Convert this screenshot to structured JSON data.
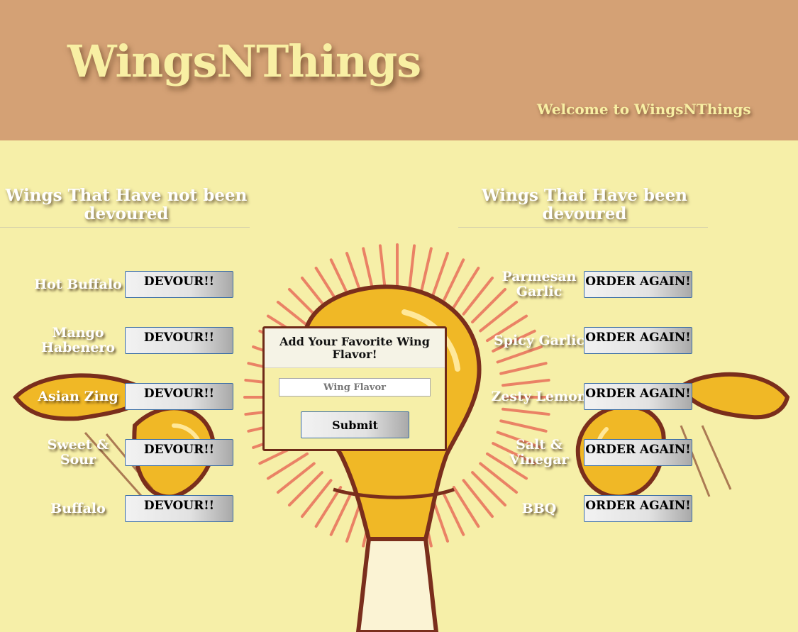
{
  "header": {
    "brand": "WingsNThings",
    "welcome": "Welcome to WingsNThings"
  },
  "columns": {
    "uneaten": {
      "heading": "Wings That Have not been devoured",
      "button_label": "DEVOUR!!",
      "items": [
        {
          "name": "Hot Buffalo"
        },
        {
          "name": "Mango Habenero"
        },
        {
          "name": "Asian Zing"
        },
        {
          "name": "Sweet & Sour"
        },
        {
          "name": "Buffalo"
        }
      ]
    },
    "devoured": {
      "heading": "Wings That Have been devoured",
      "button_label": "ORDER AGAIN!",
      "items": [
        {
          "name": "Parmesan Garlic"
        },
        {
          "name": "Spicy Garlic"
        },
        {
          "name": "Zesty Lemon"
        },
        {
          "name": "Salt & Vinegar"
        },
        {
          "name": "BBQ"
        }
      ]
    }
  },
  "form": {
    "title": "Add Your Favorite Wing Flavor!",
    "input_placeholder": "Wing Flavor",
    "input_value": "",
    "submit_label": "Submit"
  },
  "colors": {
    "header_bg": "#d4a175",
    "page_bg": "#f6efa8",
    "brand_text": "#f8efa3",
    "card_border": "#6e2a18",
    "button_border": "#3b6ea5"
  },
  "background": {
    "illustration": "wing-lightbulb-burst-art"
  }
}
